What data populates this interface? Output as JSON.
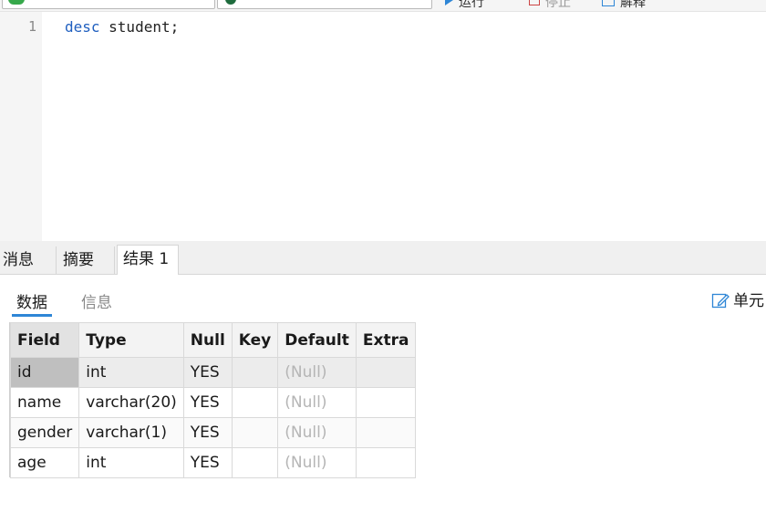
{
  "toolbar": {
    "run_label": "运行",
    "stop_label": "停止",
    "explain_label": "解释"
  },
  "editor": {
    "line_number": "1",
    "keyword": "desc",
    "rest": " student;"
  },
  "result_tabs": [
    {
      "label": "消息"
    },
    {
      "label": "摘要"
    },
    {
      "label": "结果 1",
      "active": true
    }
  ],
  "sub_tabs": {
    "data_label": "数据",
    "info_label": "信息",
    "cell_label": "单元"
  },
  "grid": {
    "columns": [
      "Field",
      "Type",
      "Null",
      "Key",
      "Default",
      "Extra"
    ],
    "rows": [
      [
        "id",
        "int",
        "YES",
        "",
        "(Null)",
        ""
      ],
      [
        "name",
        "varchar(20)",
        "YES",
        "",
        "(Null)",
        ""
      ],
      [
        "gender",
        "varchar(1)",
        "YES",
        "",
        "(Null)",
        ""
      ],
      [
        "age",
        "int",
        "YES",
        "",
        "(Null)",
        ""
      ]
    ]
  },
  "colors": {
    "accent": "#2e86d6",
    "keyword": "#1f5fbf",
    "null_text": "#b5b5b5"
  }
}
